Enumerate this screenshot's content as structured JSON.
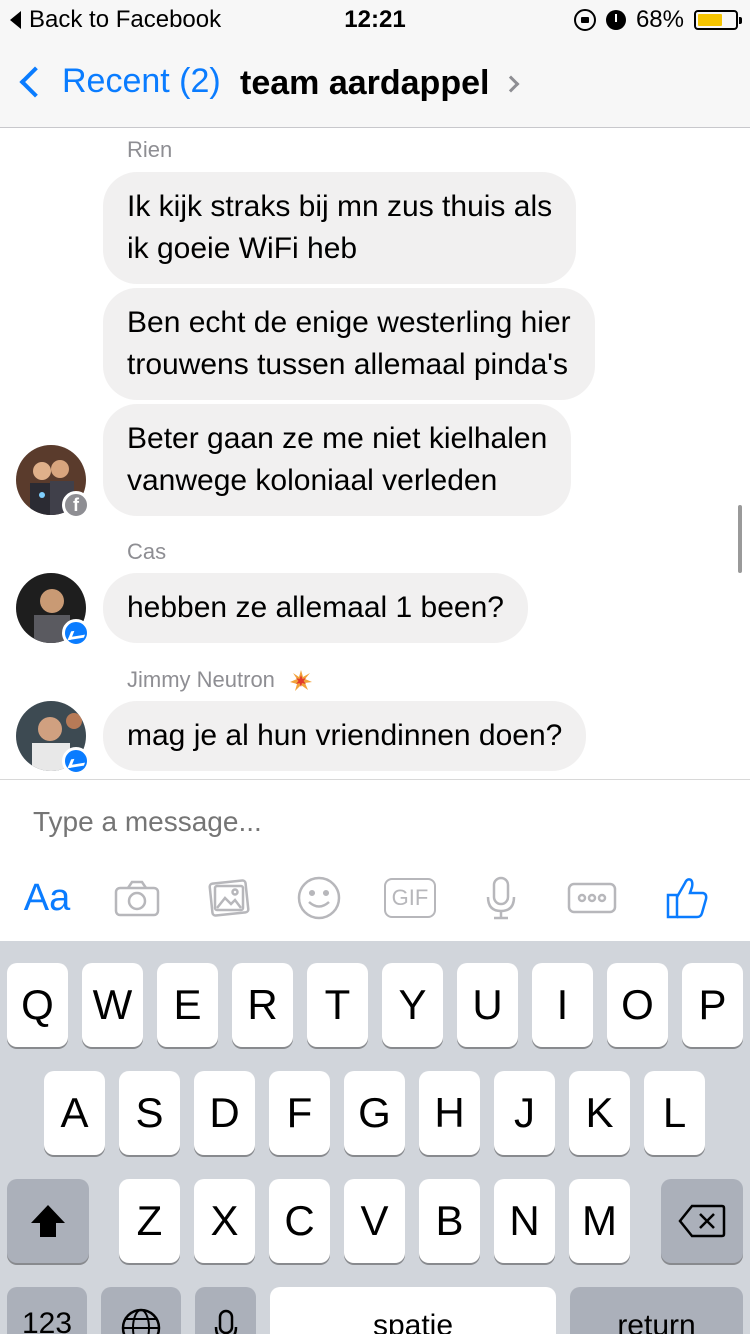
{
  "status": {
    "back_label": "Back to Facebook",
    "time": "12:21",
    "battery_pct": "68%",
    "battery_level": 0.68
  },
  "nav": {
    "back_label": "Recent (2)",
    "title": "team aardappel"
  },
  "messages": {
    "group1": {
      "sender": "Rien",
      "bubbles": [
        "Ik kijk straks bij mn zus thuis als\nik goeie WiFi heb",
        "Ben echt de enige westerling hier\ntrouwens tussen allemaal pinda's",
        "Beter gaan ze me niet kielhalen\nvanwege koloniaal verleden"
      ]
    },
    "group2": {
      "sender": "Cas",
      "bubbles": [
        "hebben ze allemaal 1 been?"
      ]
    },
    "group3": {
      "sender": "Jimmy Neutron",
      "bubbles": [
        "mag je al hun vriendinnen doen?"
      ]
    }
  },
  "composer": {
    "placeholder": "Type a message...",
    "aa_label": "Aa",
    "gif_label": "GIF",
    "accent_color": "#0a7cff"
  },
  "keyboard": {
    "row1": [
      "Q",
      "W",
      "E",
      "R",
      "T",
      "Y",
      "U",
      "I",
      "O",
      "P"
    ],
    "row2": [
      "A",
      "S",
      "D",
      "F",
      "G",
      "H",
      "J",
      "K",
      "L"
    ],
    "row3": [
      "Z",
      "X",
      "C",
      "V",
      "B",
      "N",
      "M"
    ],
    "numbers_label": "123",
    "space_label": "spatie",
    "return_label": "return"
  }
}
